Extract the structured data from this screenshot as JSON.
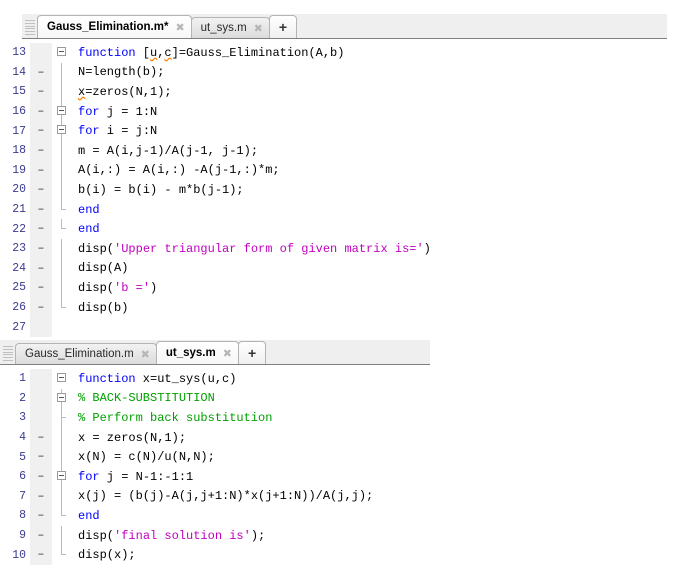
{
  "app": {
    "name": "MATLAB Editor",
    "colors": {
      "keyword": "#0000ff",
      "string": "#c000c0",
      "comment": "#00a000",
      "warning_underline": "#ff8000",
      "gutter_background": "#f0f0f0",
      "tabbar_background": "#efefef",
      "editor_background": "#ffffff",
      "linenumber": "#3b3b8f"
    }
  },
  "panels": [
    {
      "id": "panel-top",
      "tabs": [
        {
          "label": "Gauss_Elimination.m*",
          "active": true,
          "modified": true,
          "close_icon": "close-icon"
        },
        {
          "label": "ut_sys.m",
          "active": false,
          "modified": false,
          "close_icon": "close-icon"
        }
      ],
      "new_tab_label": "+",
      "lines": [
        {
          "number": "13",
          "mark": "",
          "text": "function [u,c]=Gauss_Elimination(A,b)"
        },
        {
          "number": "14",
          "mark": "–",
          "text": "N=length(b);"
        },
        {
          "number": "15",
          "mark": "–",
          "text": "x=zeros(N,1);"
        },
        {
          "number": "16",
          "mark": "–",
          "text": "for j = 1:N"
        },
        {
          "number": "17",
          "mark": "–",
          "text": "for i = j:N"
        },
        {
          "number": "18",
          "mark": "–",
          "text": "m = A(i,j-1)/A(j-1, j-1);"
        },
        {
          "number": "19",
          "mark": "–",
          "text": "A(i,:) = A(i,:) -A(j-1,:)*m;"
        },
        {
          "number": "20",
          "mark": "–",
          "text": "b(i) = b(i) - m*b(j-1);"
        },
        {
          "number": "21",
          "mark": "–",
          "text": "end"
        },
        {
          "number": "22",
          "mark": "–",
          "text": "end"
        },
        {
          "number": "23",
          "mark": "–",
          "text": "disp('Upper triangular form of given matrix is=')"
        },
        {
          "number": "24",
          "mark": "–",
          "text": "disp(A)"
        },
        {
          "number": "25",
          "mark": "–",
          "text": "disp('b =')"
        },
        {
          "number": "26",
          "mark": "–",
          "text": "disp(b)"
        },
        {
          "number": "27",
          "mark": "",
          "text": ""
        }
      ]
    },
    {
      "id": "panel-bottom",
      "tabs": [
        {
          "label": "Gauss_Elimination.m",
          "active": false,
          "modified": false,
          "close_icon": "close-icon"
        },
        {
          "label": "ut_sys.m",
          "active": true,
          "modified": false,
          "close_icon": "close-icon"
        }
      ],
      "new_tab_label": "+",
      "lines": [
        {
          "number": "1",
          "mark": "",
          "text": "function x=ut_sys(u,c)"
        },
        {
          "number": "2",
          "mark": "",
          "text": "% BACK-SUBSTITUTION"
        },
        {
          "number": "3",
          "mark": "",
          "text": "% Perform back substitution"
        },
        {
          "number": "4",
          "mark": "–",
          "text": "x = zeros(N,1);"
        },
        {
          "number": "5",
          "mark": "–",
          "text": "x(N) = c(N)/u(N,N);"
        },
        {
          "number": "6",
          "mark": "–",
          "text": "for j = N-1:-1:1"
        },
        {
          "number": "7",
          "mark": "–",
          "text": "x(j) = (b(j)-A(j,j+1:N)*x(j+1:N))/A(j,j);"
        },
        {
          "number": "8",
          "mark": "–",
          "text": "end"
        },
        {
          "number": "9",
          "mark": "–",
          "text": "disp('final solution is');"
        },
        {
          "number": "10",
          "mark": "–",
          "text": "disp(x);"
        }
      ]
    }
  ]
}
